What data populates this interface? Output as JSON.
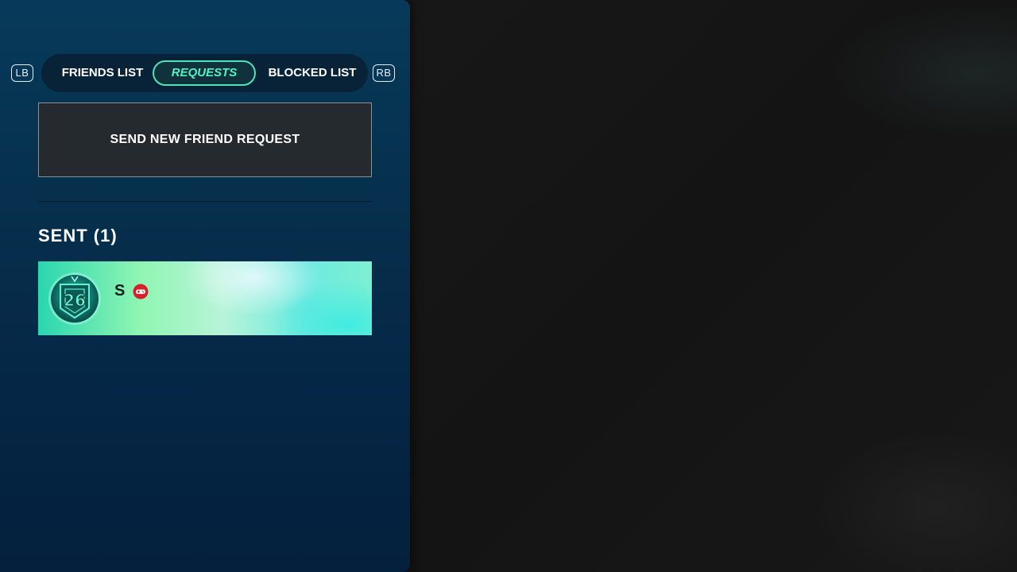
{
  "tabs": {
    "left_bumper": "LB",
    "right_bumper": "RB",
    "items": [
      {
        "label": "FRIENDS LIST",
        "active": false
      },
      {
        "label": "REQUESTS",
        "active": true
      },
      {
        "label": "BLOCKED LIST",
        "active": false
      }
    ]
  },
  "send_request": {
    "label": "SEND NEW FRIEND REQUEST"
  },
  "sent_section": {
    "title": "SENT (1)",
    "requests": [
      {
        "username": "S",
        "avatar_icon": "badge-26-icon",
        "platform_icon": "gamepad-icon"
      }
    ]
  },
  "colors": {
    "accent": "#57f0c6",
    "panel": "#06304d",
    "platform_badge": "#d8202a"
  }
}
